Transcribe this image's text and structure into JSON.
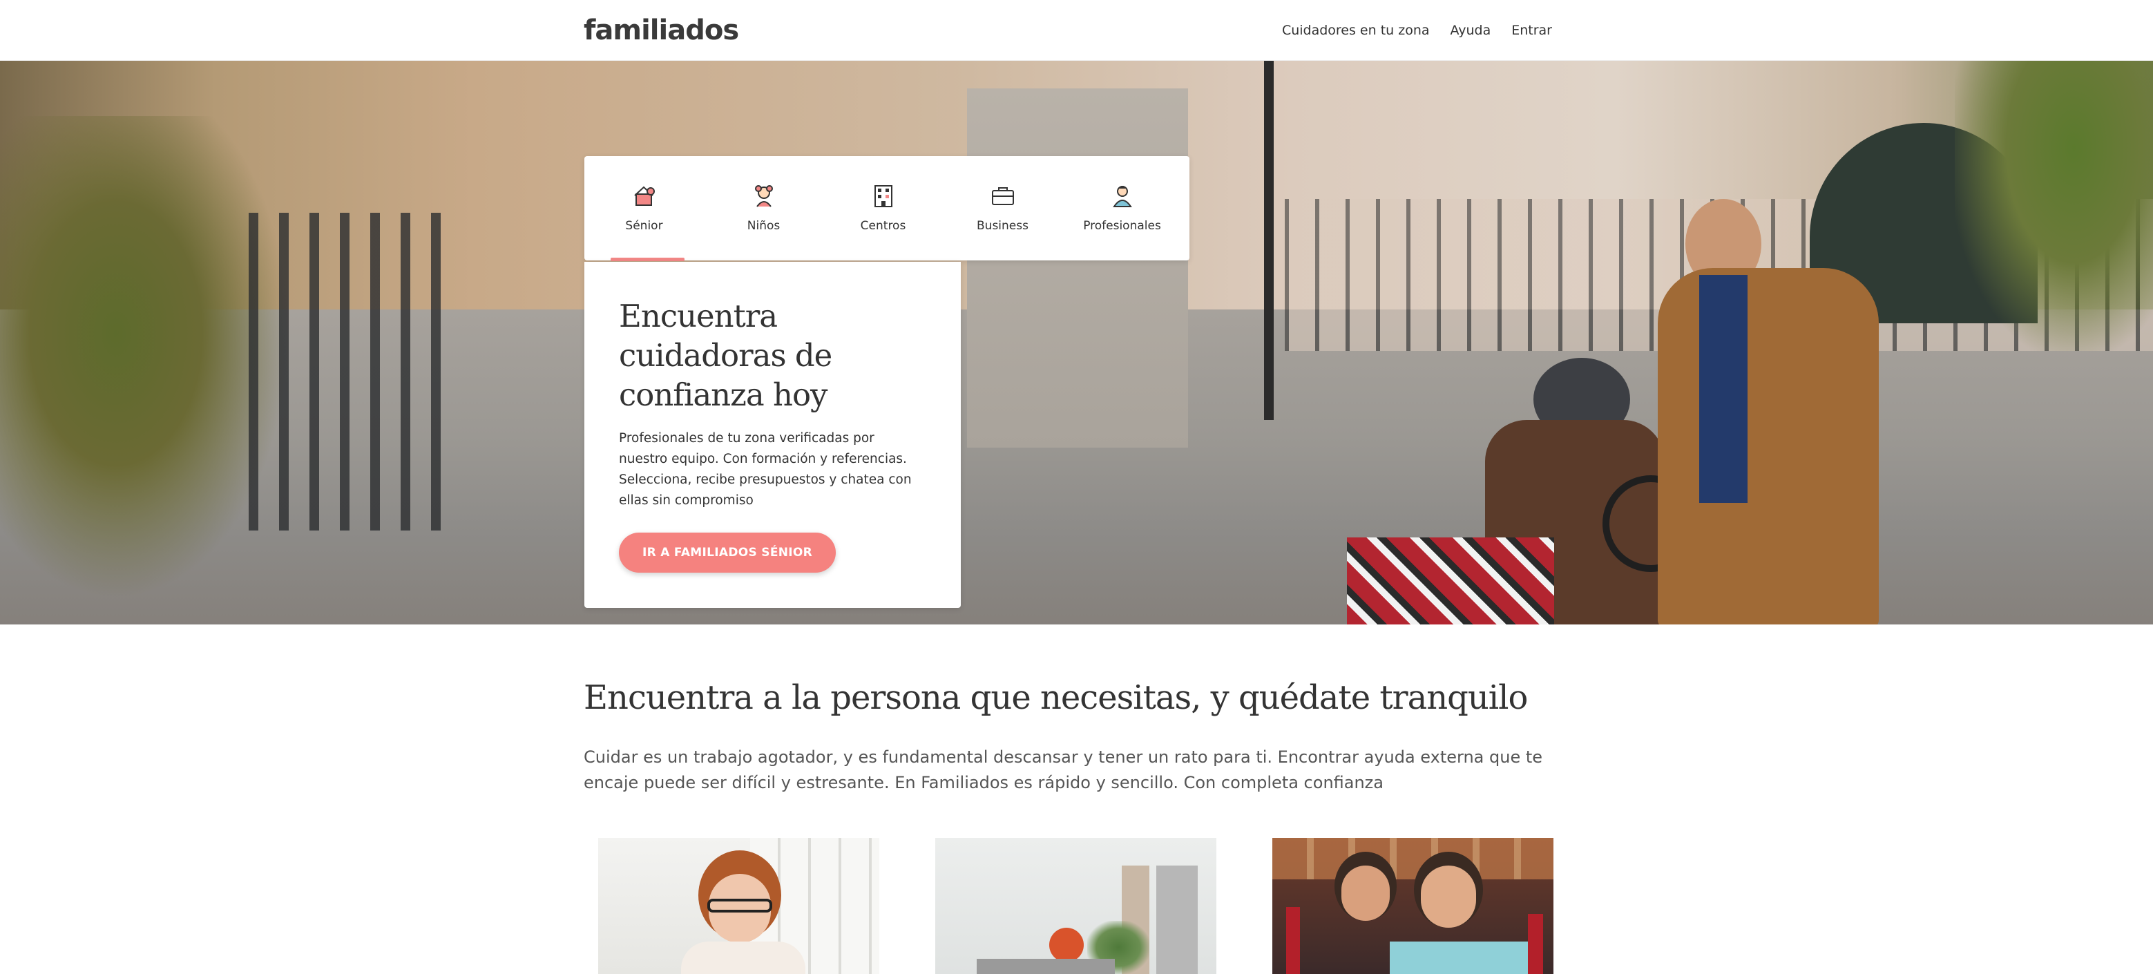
{
  "header": {
    "logo": "familiados",
    "nav": [
      {
        "label": "Cuidadores en tu zona"
      },
      {
        "label": "Ayuda"
      },
      {
        "label": "Entrar"
      }
    ]
  },
  "tabs": [
    {
      "label": "Sénior",
      "icon": "senior-icon",
      "active": true
    },
    {
      "label": "Niños",
      "icon": "child-icon",
      "active": false
    },
    {
      "label": "Centros",
      "icon": "building-icon",
      "active": false
    },
    {
      "label": "Business",
      "icon": "briefcase-icon",
      "active": false
    },
    {
      "label": "Profesionales",
      "icon": "professional-icon",
      "active": false
    }
  ],
  "hero": {
    "title": "Encuentra cuidadoras de confianza hoy",
    "description": "Profesionales de tu zona verificadas por nuestro equipo. Con formación y referencias. Selecciona, recibe presupuestos y chatea con ellas sin compromiso",
    "cta_label": "IR A FAMILIADOS SÉNIOR"
  },
  "section": {
    "title": "Encuentra a la persona que necesitas, y quédate tranquilo",
    "body": "Cuidar es un trabajo agotador, y es fundamental descansar y tener un rato para ti. Encontrar ayuda externa que te encaje puede ser difícil y estresante. En Familiados es rápido y sencillo. Con completa confianza"
  },
  "colors": {
    "accent": "#f5827f",
    "tab_active_underline": "#f28786",
    "text": "#333333"
  }
}
